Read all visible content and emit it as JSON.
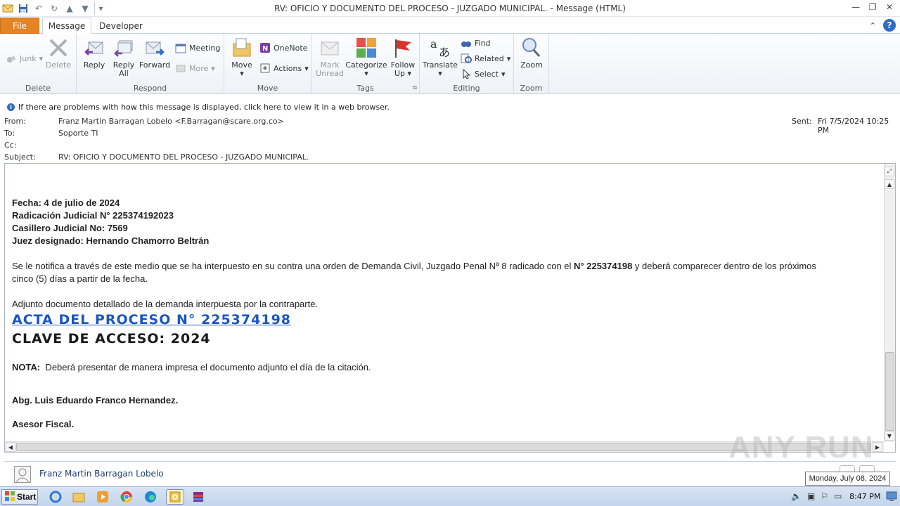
{
  "window": {
    "title": "RV: OFICIO Y DOCUMENTO DEL PROCESO - JUZGADO MUNICIPAL.  -  Message (HTML)"
  },
  "tabs": {
    "file": "File",
    "message": "Message",
    "developer": "Developer"
  },
  "ribbon": {
    "delete_group": {
      "label": "Delete",
      "junk": "Junk",
      "delete": "Delete"
    },
    "respond_group": {
      "label": "Respond",
      "reply": "Reply",
      "reply_all_1": "Reply",
      "reply_all_2": "All",
      "forward": "Forward",
      "meeting": "Meeting",
      "more": "More"
    },
    "move_group": {
      "label": "Move",
      "move": "Move",
      "onenote": "OneNote",
      "actions": "Actions"
    },
    "tags_group": {
      "label": "Tags",
      "mark_unread_1": "Mark",
      "mark_unread_2": "Unread",
      "categorize": "Categorize",
      "follow_up_1": "Follow",
      "follow_up_2": "Up"
    },
    "editing_group": {
      "label": "Editing",
      "translate": "Translate",
      "find": "Find",
      "related": "Related",
      "select": "Select"
    },
    "zoom_group": {
      "label": "Zoom",
      "zoom": "Zoom"
    }
  },
  "infobar": {
    "text": "If there are problems with how this message is displayed, click here to view it in a web browser."
  },
  "header": {
    "from_label": "From:",
    "from_value": "Franz Martin Barragan Lobelo <F.Barragan@scare.org.co>",
    "to_label": "To:",
    "to_value": "Soporte TI",
    "cc_label": "Cc:",
    "subject_label": "Subject:",
    "subject_value": "RV: OFICIO Y DOCUMENTO DEL PROCESO - JUZGADO MUNICIPAL.",
    "sent_label": "Sent:",
    "sent_value": "Fri 7/5/2024 10:25 PM"
  },
  "body": {
    "fecha": "Fecha: 4 de julio de 2024",
    "radicacion": "Radicación Judicial N° 225374192023",
    "casillero": "Casillero Judicial No: 7569",
    "juez": "Juez designado: Hernando Chamorro Beltrán",
    "notif_1": "Se le notifica a través de este medio que se ha interpuesto en su contra una orden de Demanda Civil, Juzgado Penal Nª 8 radicado con el ",
    "notif_bold": "N° 225374198",
    "notif_2": " y deberá comparecer dentro de los próximos",
    "notif_3": "cinco (5) días a partir de la fecha.",
    "adjunto": "Adjunto documento detallado de la demanda interpuesta por la contraparte.",
    "acta_link": "ACTA DEL PROCESO N° 225374198",
    "clave": "CLAVE DE ACCESO: 2024",
    "nota_label": "NOTA:",
    "nota_text": "  Deberá presentar de manera impresa el documento adjunto el día de la citación.",
    "firma": "Abg. Luis Eduardo Franco Hernandez.",
    "cargo": "Asesor Fiscal."
  },
  "people_pane": {
    "name": "Franz Martin Barragan Lobelo"
  },
  "taskbar": {
    "start": "Start",
    "time": "8:47 PM",
    "tooltip_date": "Monday, July 08, 2024"
  },
  "watermark": "ANY RUN",
  "colors": {
    "file_tab": "#e58425",
    "link": "#1a56c0",
    "accent": "#2d6cc7"
  }
}
